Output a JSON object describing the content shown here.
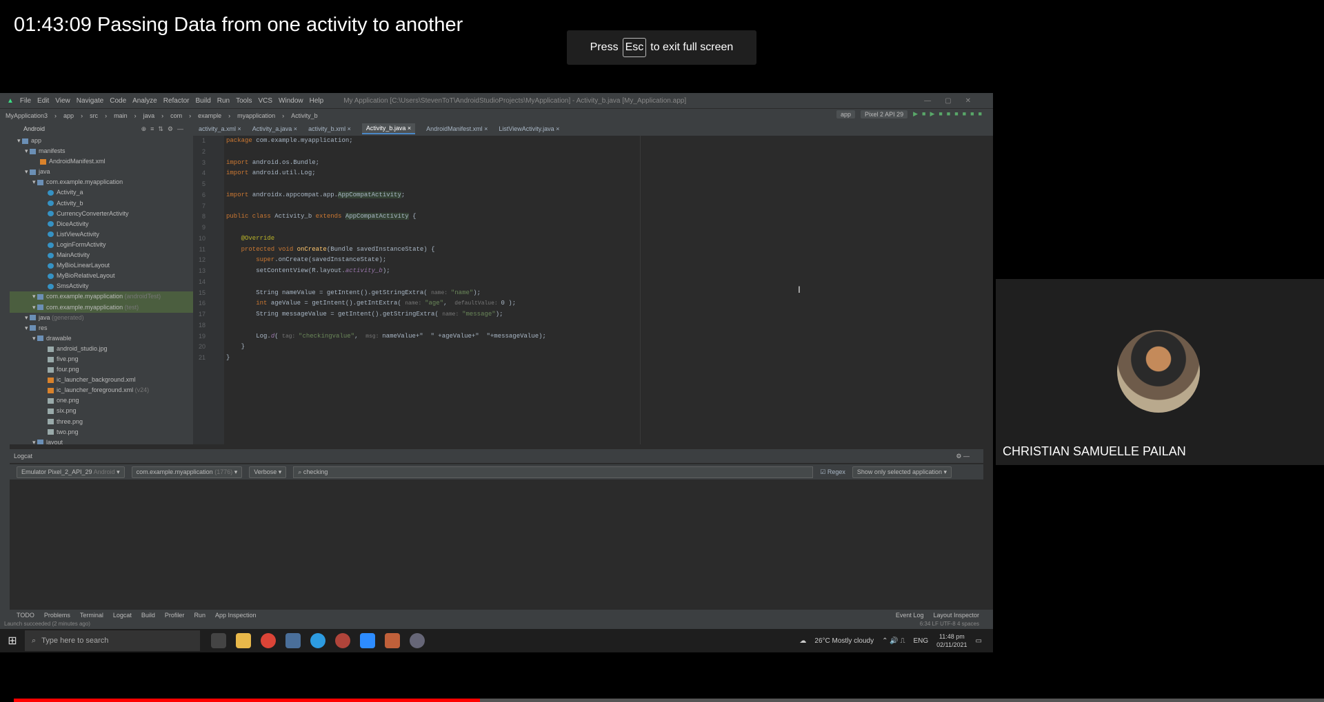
{
  "video": {
    "title": "01:43:09 Passing Data from one activity to another",
    "progress_fraction": 0.356
  },
  "fullscreen_notice": {
    "prefix": "Press",
    "key": "Esc",
    "suffix": "to exit full screen"
  },
  "ide": {
    "menu": [
      "File",
      "Edit",
      "View",
      "Navigate",
      "Code",
      "Analyze",
      "Refactor",
      "Build",
      "Run",
      "Tools",
      "VCS",
      "Window",
      "Help"
    ],
    "window_title": "My Application [C:\\Users\\StevenToT\\AndroidStudioProjects\\MyApplication] - Activity_b.java [My_Application.app]",
    "breadcrumbs": [
      "MyApplication3",
      "app",
      "src",
      "main",
      "java",
      "com",
      "example",
      "myapplication",
      "Activity_b"
    ],
    "toolbar": {
      "run_config": "app",
      "device": "Pixel 2 API 29"
    },
    "project_view": "Android",
    "tabs": [
      "activity_a.xml",
      "Activity_a.java",
      "activity_b.xml",
      "Activity_b.java",
      "AndroidManifest.xml",
      "ListViewActivity.java"
    ],
    "tree": [
      {
        "label": "app",
        "kind": "fold",
        "indent": 1
      },
      {
        "label": "manifests",
        "kind": "fold",
        "indent": 2
      },
      {
        "label": "AndroidManifest.xml",
        "kind": "xml",
        "indent": 4
      },
      {
        "label": "java",
        "kind": "fold",
        "indent": 2
      },
      {
        "label": "com.example.myapplication",
        "kind": "fold",
        "indent": 3
      },
      {
        "label": "Activity_a",
        "kind": "cls",
        "indent": 5
      },
      {
        "label": "Activity_b",
        "kind": "cls",
        "indent": 5
      },
      {
        "label": "CurrencyConverterActivity",
        "kind": "cls",
        "indent": 5
      },
      {
        "label": "DiceActivity",
        "kind": "cls",
        "indent": 5
      },
      {
        "label": "ListViewActivity",
        "kind": "cls",
        "indent": 5
      },
      {
        "label": "LoginFormActivity",
        "kind": "cls",
        "indent": 5
      },
      {
        "label": "MainActivity",
        "kind": "cls",
        "indent": 5
      },
      {
        "label": "MyBioLinearLayout",
        "kind": "cls",
        "indent": 5
      },
      {
        "label": "MyBioRelativeLayout",
        "kind": "cls",
        "indent": 5
      },
      {
        "label": "SmsActivity",
        "kind": "cls",
        "indent": 5
      },
      {
        "label": "com.example.myapplication",
        "suffix": "(androidTest)",
        "kind": "fold",
        "indent": 3,
        "highlight": true
      },
      {
        "label": "com.example.myapplication",
        "suffix": "(test)",
        "kind": "fold",
        "indent": 3,
        "highlight": true
      },
      {
        "label": "java",
        "suffix": "(generated)",
        "kind": "fold",
        "indent": 2
      },
      {
        "label": "res",
        "kind": "fold",
        "indent": 2
      },
      {
        "label": "drawable",
        "kind": "fold",
        "indent": 3
      },
      {
        "label": "android_studio.jpg",
        "kind": "file",
        "indent": 5
      },
      {
        "label": "five.png",
        "kind": "file",
        "indent": 5
      },
      {
        "label": "four.png",
        "kind": "file",
        "indent": 5
      },
      {
        "label": "ic_launcher_background.xml",
        "kind": "xml",
        "indent": 5
      },
      {
        "label": "ic_launcher_foreground.xml",
        "suffix": "(v24)",
        "kind": "xml",
        "indent": 5
      },
      {
        "label": "one.png",
        "kind": "file",
        "indent": 5
      },
      {
        "label": "six.png",
        "kind": "file",
        "indent": 5
      },
      {
        "label": "three.png",
        "kind": "file",
        "indent": 5
      },
      {
        "label": "two.png",
        "kind": "file",
        "indent": 5
      },
      {
        "label": "layout",
        "kind": "fold",
        "indent": 3
      }
    ],
    "line_numbers": [
      "1",
      "2",
      "3",
      "4",
      "5",
      "6",
      "7",
      "8",
      "9",
      "10",
      "11",
      "12",
      "13",
      "14",
      "15",
      "16",
      "17",
      "18",
      "19",
      "20",
      "21"
    ],
    "code": [
      [
        {
          "t": "package ",
          "c": "kw"
        },
        {
          "t": "com.example.myapplication;"
        }
      ],
      [],
      [
        {
          "t": "import ",
          "c": "kw"
        },
        {
          "t": "android.os.Bundle;"
        }
      ],
      [
        {
          "t": "import ",
          "c": "kw"
        },
        {
          "t": "android.util.Log;"
        }
      ],
      [],
      [
        {
          "t": "import ",
          "c": "kw"
        },
        {
          "t": "androidx.appcompat.app."
        },
        {
          "t": "AppCompatActivity",
          "c": "cls"
        },
        {
          "t": ";"
        }
      ],
      [],
      [
        {
          "t": "public class ",
          "c": "kw"
        },
        {
          "t": "Activity_b "
        },
        {
          "t": "extends ",
          "c": "kw"
        },
        {
          "t": "AppCompatActivity",
          "c": "cls"
        },
        {
          "t": " {"
        }
      ],
      [],
      [
        {
          "t": "    @Override",
          "c": "ann"
        }
      ],
      [
        {
          "t": "    protected void ",
          "c": "kw"
        },
        {
          "t": "onCreate",
          "c": "meth"
        },
        {
          "t": "(Bundle savedInstanceState) {"
        }
      ],
      [
        {
          "t": "        super",
          "c": "kw"
        },
        {
          "t": ".onCreate(savedInstanceState);"
        }
      ],
      [
        {
          "t": "        setContentView(R.layout."
        },
        {
          "t": "activity_b",
          "c": "field"
        },
        {
          "t": ");"
        }
      ],
      [],
      [
        {
          "t": "        String nameValue = getIntent().getStringExtra( "
        },
        {
          "t": "name: ",
          "c": "hint"
        },
        {
          "t": "\"name\"",
          "c": "str"
        },
        {
          "t": ");"
        }
      ],
      [
        {
          "t": "        int ",
          "c": "kw"
        },
        {
          "t": "ageValue = getIntent().getIntExtra( "
        },
        {
          "t": "name: ",
          "c": "hint"
        },
        {
          "t": "\"age\"",
          "c": "str"
        },
        {
          "t": ",  "
        },
        {
          "t": "defaultValue: ",
          "c": "hint"
        },
        {
          "t": "0 );"
        }
      ],
      [
        {
          "t": "        String messageValue = getIntent().getStringExtra( "
        },
        {
          "t": "name: ",
          "c": "hint"
        },
        {
          "t": "\"message\"",
          "c": "str"
        },
        {
          "t": ");"
        }
      ],
      [],
      [
        {
          "t": "        Log."
        },
        {
          "t": "d",
          "c": "field"
        },
        {
          "t": "( "
        },
        {
          "t": "tag: ",
          "c": "hint"
        },
        {
          "t": "\"checkingvalue\"",
          "c": "str"
        },
        {
          "t": ",  "
        },
        {
          "t": "msg: ",
          "c": "hint"
        },
        {
          "t": "nameValue+\"  \" +ageValue+\"  \"+messageValue);"
        }
      ],
      [
        {
          "t": "    }"
        }
      ],
      [
        {
          "t": "}"
        }
      ]
    ],
    "logcat": {
      "title": "Logcat",
      "device": "Emulator Pixel_2_API_29",
      "device_suffix": "Android",
      "process": "com.example.myapplication",
      "process_pid": "(1776)",
      "level": "Verbose",
      "filter": "checking",
      "regex_label": "Regex",
      "show_option": "Show only selected application"
    },
    "bottom_tabs": [
      "TODO",
      "Problems",
      "Terminal",
      "Logcat",
      "Build",
      "Profiler",
      "Run",
      "App Inspection"
    ],
    "bottom_right": [
      "Event Log",
      "Layout Inspector"
    ],
    "status": "Launch succeeded (2 minutes ago)",
    "status_right": "6:34  LF  UTF-8  4 spaces"
  },
  "taskbar": {
    "search_placeholder": "Type here to search",
    "weather": "26°C  Mostly cloudy",
    "lang": "ENG",
    "time": "11:48 pm",
    "date": "02/11/2021"
  },
  "participant": {
    "name": "CHRISTIAN SAMUELLE PAILAN"
  }
}
